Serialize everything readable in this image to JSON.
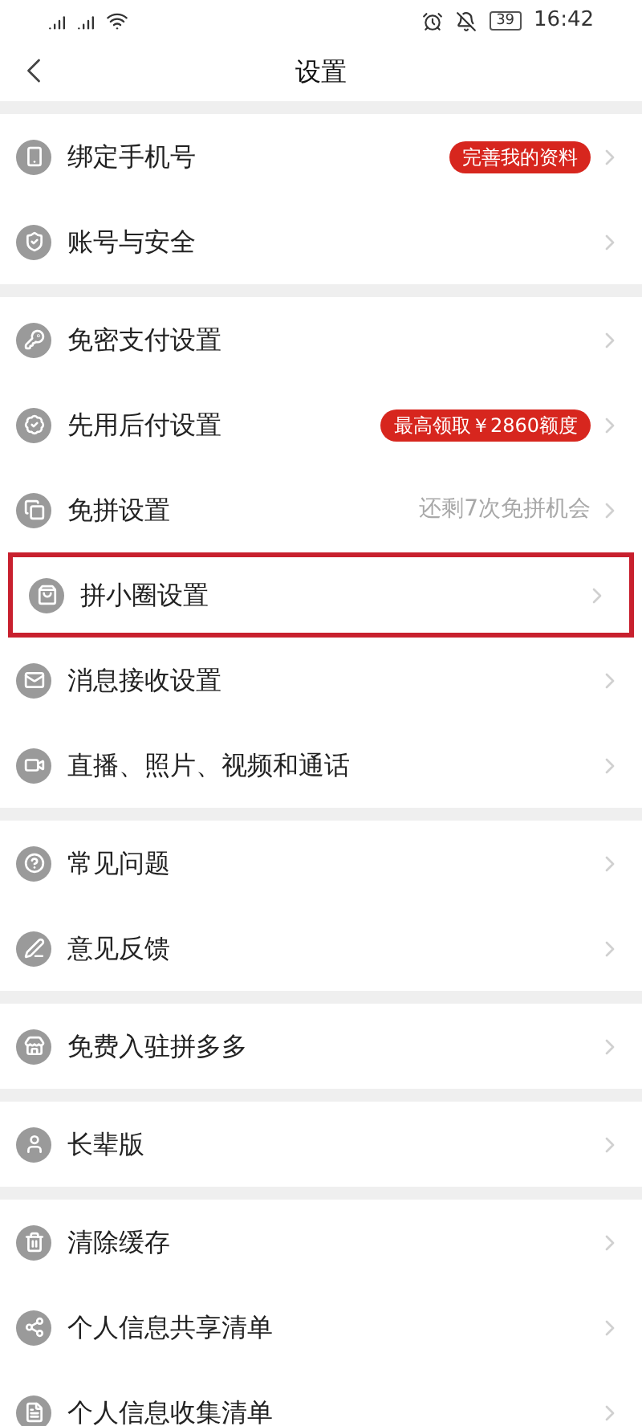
{
  "status_bar": {
    "battery": "39",
    "time": "16:42"
  },
  "nav": {
    "title": "设置"
  },
  "groups": [
    {
      "items": [
        {
          "label": "绑定手机号",
          "badge": "完善我的资料",
          "highlighted": false
        },
        {
          "label": "账号与安全",
          "highlighted": false
        }
      ]
    },
    {
      "items": [
        {
          "label": "免密支付设置",
          "highlighted": false
        },
        {
          "label": "先用后付设置",
          "badge": "最高领取￥2860额度",
          "highlighted": false
        },
        {
          "label": "免拼设置",
          "hint": "还剩7次免拼机会",
          "highlighted": false
        },
        {
          "label": "拼小圈设置",
          "highlighted": true
        },
        {
          "label": "消息接收设置",
          "highlighted": false
        },
        {
          "label": "直播、照片、视频和通话",
          "highlighted": false
        }
      ]
    },
    {
      "items": [
        {
          "label": "常见问题",
          "highlighted": false
        },
        {
          "label": "意见反馈",
          "highlighted": false
        }
      ]
    },
    {
      "items": [
        {
          "label": "免费入驻拼多多",
          "highlighted": false
        }
      ]
    },
    {
      "items": [
        {
          "label": "长辈版",
          "highlighted": false
        }
      ]
    },
    {
      "items": [
        {
          "label": "清除缓存",
          "highlighted": false
        },
        {
          "label": "个人信息共享清单",
          "highlighted": false
        },
        {
          "label": "个人信息收集清单",
          "highlighted": false
        }
      ]
    }
  ]
}
